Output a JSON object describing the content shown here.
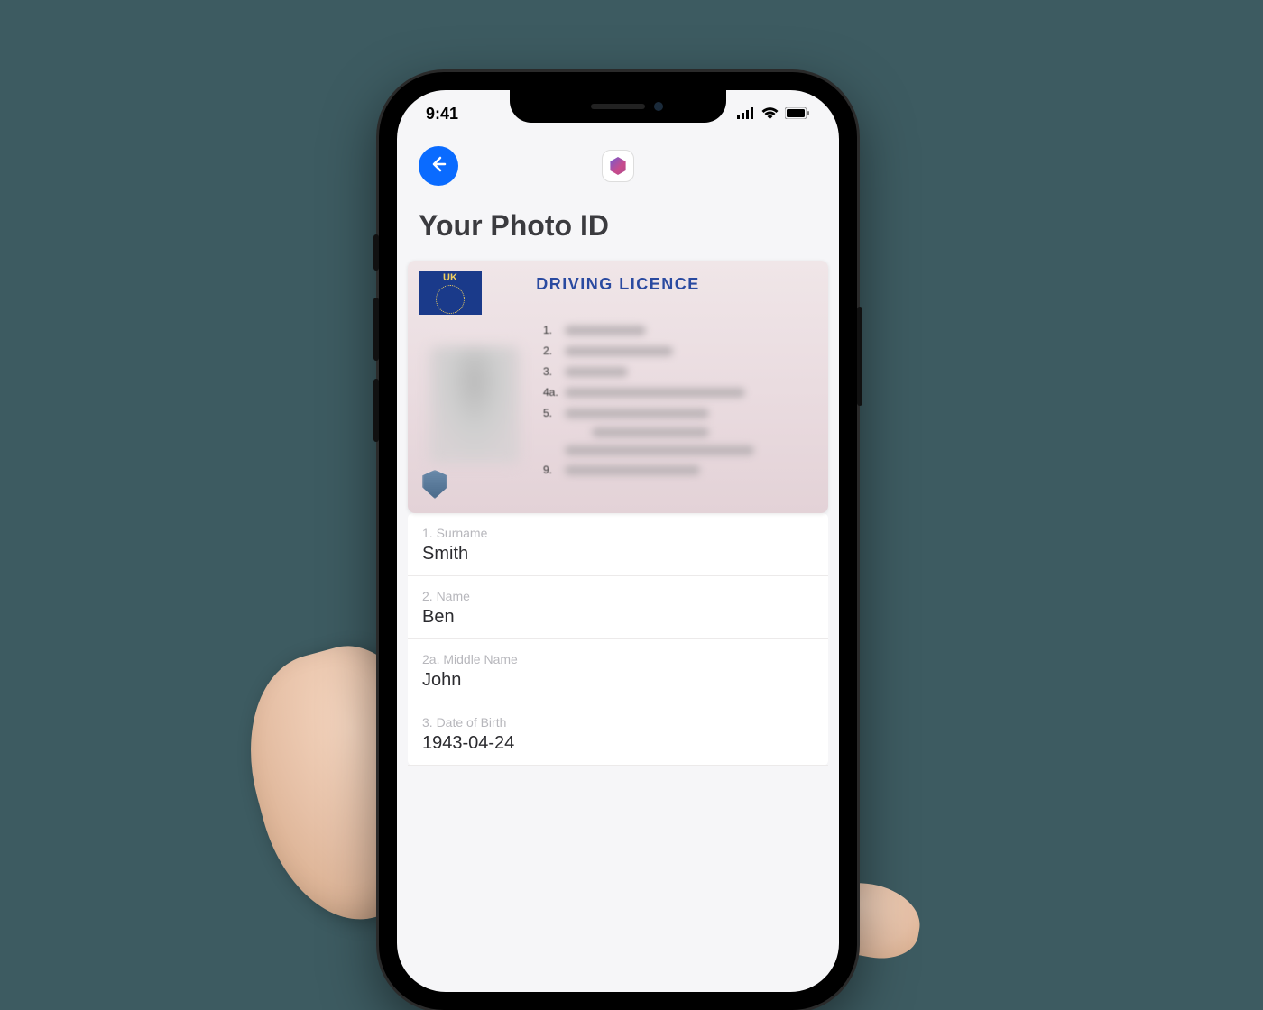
{
  "status": {
    "time": "9:41"
  },
  "page": {
    "title": "Your Photo ID"
  },
  "document": {
    "flag_code": "UK",
    "header": "DRIVING LICENCE",
    "line_numbers": [
      "1.",
      "2.",
      "3.",
      "4a.",
      "5.",
      "",
      "",
      "9."
    ]
  },
  "fields": [
    {
      "label": "1. Surname",
      "value": "Smith"
    },
    {
      "label": "2. Name",
      "value": "Ben"
    },
    {
      "label": "2a. Middle Name",
      "value": "John"
    },
    {
      "label": "3. Date of Birth",
      "value": "1943-04-24"
    }
  ]
}
